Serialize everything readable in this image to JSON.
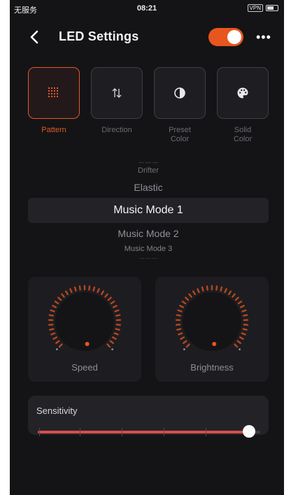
{
  "status_bar": {
    "carrier": "无服务",
    "time": "08:21",
    "battery_chip": "VPN"
  },
  "header": {
    "title": "LED Settings",
    "power_on": true
  },
  "modes": [
    {
      "label": "Pattern",
      "icon": "pattern-grid-icon",
      "active": true
    },
    {
      "label": "Direction",
      "icon": "direction-arrows-icon",
      "active": false
    },
    {
      "label": "Preset\nColor",
      "icon": "half-circle-icon",
      "active": false
    },
    {
      "label": "Solid\nColor",
      "icon": "palette-icon",
      "active": false
    }
  ],
  "picker": {
    "items_above": [
      "Drifter",
      "Elastic"
    ],
    "selected": "Music Mode 1",
    "items_below": [
      "Music Mode 2",
      "Music Mode 3"
    ]
  },
  "knobs": [
    {
      "label": "Speed",
      "level": 0.25
    },
    {
      "label": "Brightness",
      "level": 0.2
    }
  ],
  "sensitivity": {
    "label": "Sensitivity",
    "value": 0.95
  },
  "colors": {
    "accent": "#e8561f",
    "slider_fill": "#d84f48",
    "background": "#141416",
    "card": "#1d1d21"
  }
}
